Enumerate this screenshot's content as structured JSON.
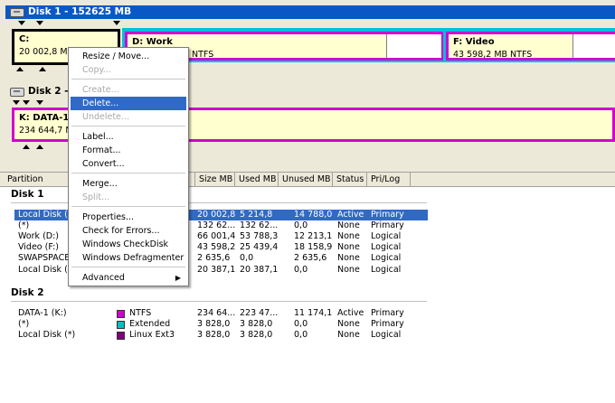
{
  "disk1": {
    "title": "Disk 1 - 152625 MB",
    "partitions": [
      {
        "name": "C:",
        "info": "20 002,8 MB"
      },
      {
        "name": "D:  Work",
        "info": "NTFS"
      },
      {
        "name": "F:  Video",
        "info": "43 598,2 MB     NTFS"
      }
    ]
  },
  "disk2": {
    "title": "Disk 2 -",
    "partitions": [
      {
        "name": "K:  DATA-1",
        "info": "234 644,7 MB"
      }
    ]
  },
  "columns": [
    "Partition",
    "Size MB",
    "Used MB",
    "Unused MB",
    "Status",
    "Pri/Log"
  ],
  "groups": [
    "Disk 1",
    "Disk 2"
  ],
  "rows_disk1": [
    {
      "partition": "Local Disk (C:)",
      "size": "20 002,8",
      "used": "5 214,8",
      "unused": "14 788,0",
      "status": "Active",
      "prilog": "Primary"
    },
    {
      "partition": "(*)",
      "size": "132 62...",
      "used": "132 62...",
      "unused": "0,0",
      "status": "None",
      "prilog": "Primary"
    },
    {
      "partition": "Work (D:)",
      "size": "66 001,4",
      "used": "53 788,3",
      "unused": "12 213,1",
      "status": "None",
      "prilog": "Logical"
    },
    {
      "partition": "Video (F:)",
      "size": "43 598,2",
      "used": "25 439,4",
      "unused": "18 158,9",
      "status": "None",
      "prilog": "Logical"
    },
    {
      "partition": "SWAPSPACE",
      "size": "2 635,6",
      "used": "0,0",
      "unused": "2 635,6",
      "status": "None",
      "prilog": "Logical"
    },
    {
      "partition": "Local Disk (*)",
      "size": "20 387,1",
      "used": "20 387,1",
      "unused": "0,0",
      "status": "None",
      "prilog": "Logical"
    }
  ],
  "rows_disk2": [
    {
      "partition": "DATA-1 (K:)",
      "fs": "NTFS",
      "fs_color": "#d000d0",
      "size": "234 64...",
      "used": "223 47...",
      "unused": "11 174,1",
      "status": "Active",
      "prilog": "Primary"
    },
    {
      "partition": "(*)",
      "fs": "Extended",
      "fs_color": "#00c0c0",
      "size": "3 828,0",
      "used": "3 828,0",
      "unused": "0,0",
      "status": "None",
      "prilog": "Primary"
    },
    {
      "partition": "Local Disk (*)",
      "fs": "Linux Ext3",
      "fs_color": "#800080",
      "size": "3 828,0",
      "used": "3 828,0",
      "unused": "0,0",
      "status": "None",
      "prilog": "Logical"
    }
  ],
  "menu": {
    "items": [
      {
        "label": "Resize / Move...",
        "disabled": false
      },
      {
        "label": "Copy...",
        "disabled": true
      },
      {
        "label": "Create...",
        "disabled": true
      },
      {
        "label": "Delete...",
        "disabled": false,
        "highlighted": true
      },
      {
        "label": "Undelete...",
        "disabled": true
      },
      {
        "label": "Label...",
        "disabled": false
      },
      {
        "label": "Format...",
        "disabled": false
      },
      {
        "label": "Convert...",
        "disabled": false
      },
      {
        "label": "Merge...",
        "disabled": false
      },
      {
        "label": "Split...",
        "disabled": true
      },
      {
        "label": "Properties...",
        "disabled": false
      },
      {
        "label": "Check for Errors...",
        "disabled": false
      },
      {
        "label": "Windows CheckDisk",
        "disabled": false
      },
      {
        "label": "Windows Defragmenter",
        "disabled": false
      },
      {
        "label": "Advanced",
        "disabled": false,
        "submenu": true
      }
    ]
  },
  "colors": {
    "disk_title_bar": "#0a58c6",
    "selection": "#316ac5",
    "primary_border": "#d000d0",
    "extended_bar": "#00c0d8",
    "partition_fill": "#ffffd0"
  }
}
